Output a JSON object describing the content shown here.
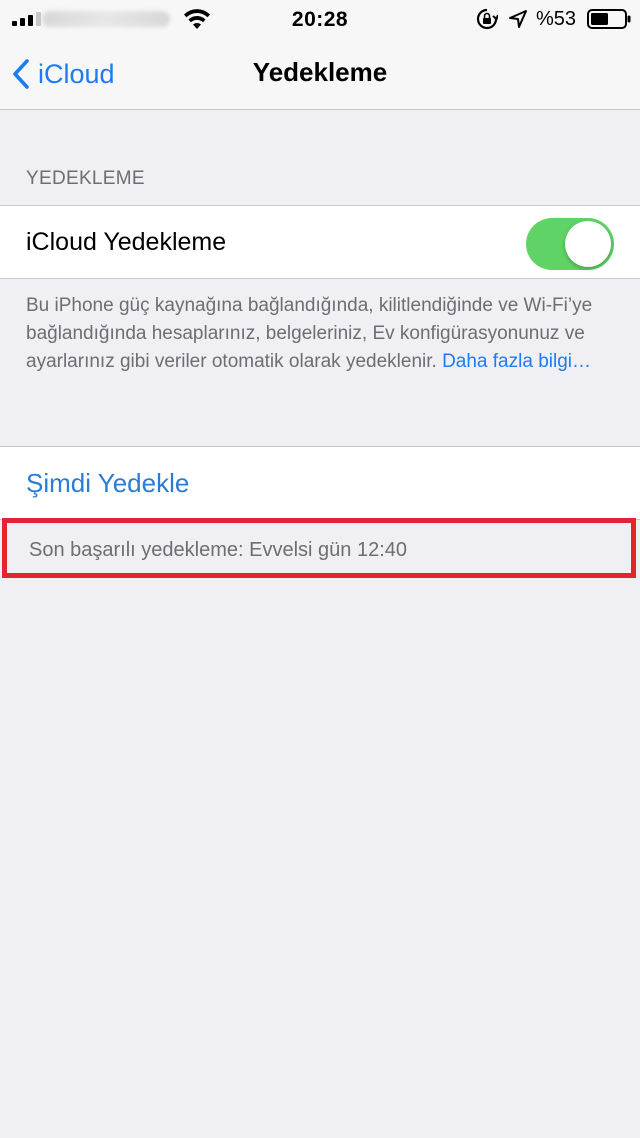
{
  "status_bar": {
    "time": "20:28",
    "battery_percent": "%53",
    "battery_level": 0.53,
    "icons": [
      "signal-icon",
      "wifi-icon",
      "rotation-lock-icon",
      "location-icon",
      "battery-icon"
    ]
  },
  "nav": {
    "back_label": "iCloud",
    "title": "Yedekleme"
  },
  "section": {
    "header": "YEDEKLEME",
    "toggle_label": "iCloud Yedekleme",
    "toggle_on": true,
    "description": "Bu iPhone güç kaynağına bağlandığında, kilitlendiğinde ve Wi-Fi’ye bağlandığında hesaplarınız, belgeleriniz, Ev konfigürasyonunuz ve ayarlarınız gibi veriler otomatik olarak yedeklenir.",
    "learn_more": "Daha fazla bilgi…"
  },
  "backup": {
    "action_label": "Şimdi Yedekle",
    "last_backup": "Son başarılı yedekleme: Evvelsi gün 12:40"
  },
  "colors": {
    "accent": "#1e7cf2",
    "toggle_on": "#5fd365",
    "highlight": "#e42430",
    "background": "#efeff4"
  }
}
